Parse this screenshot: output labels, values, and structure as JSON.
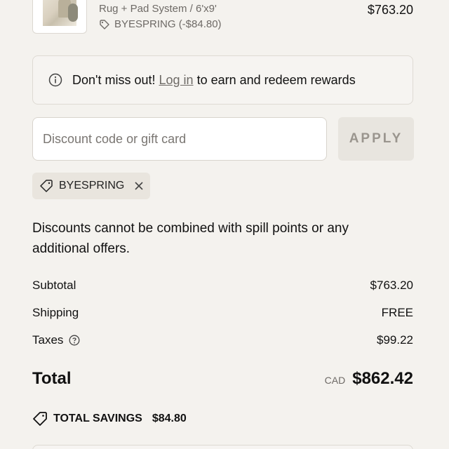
{
  "product": {
    "variant": "Rug + Pad System / 6'x9'",
    "discount_tag": "BYESPRING (-$84.80)",
    "price": "$763.20"
  },
  "notice": {
    "prefix": "Don't miss out!",
    "link": "Log in",
    "suffix": "to earn and redeem rewards"
  },
  "discount": {
    "placeholder": "Discount code or gift card",
    "apply_label": "APPLY",
    "applied_code": "BYESPRING"
  },
  "note": "Discounts cannot be combined with spill points or any additional offers.",
  "summary": {
    "subtotal_label": "Subtotal",
    "subtotal_value": "$763.20",
    "shipping_label": "Shipping",
    "shipping_value": "FREE",
    "taxes_label": "Taxes",
    "taxes_value": "$99.22",
    "total_label": "Total",
    "currency": "CAD",
    "total_value": "$862.42"
  },
  "savings": {
    "label": "TOTAL SAVINGS",
    "value": "$84.80"
  },
  "icons": {
    "tag": "tag-icon",
    "info": "info-icon",
    "close": "close-icon",
    "help": "help-icon"
  }
}
